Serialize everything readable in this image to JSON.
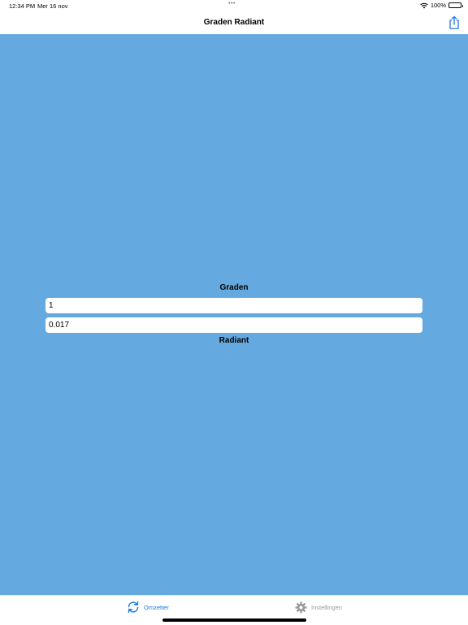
{
  "status_bar": {
    "time": "12:34 PM",
    "date": "Mer 16 nov",
    "multitask_dots": "•••",
    "battery_text": "100%",
    "wifi_icon": "wifi-icon",
    "battery_icon": "battery-icon"
  },
  "nav": {
    "title": "Graden Radiant",
    "share_icon": "share-icon"
  },
  "converter": {
    "top_label": "Graden",
    "degrees_value": "1",
    "radians_value": "0.017",
    "bottom_label": "Radiant",
    "background_color": "#64a9e0"
  },
  "tabs": [
    {
      "label": "Omzetter",
      "icon": "sync-icon",
      "selected": true,
      "color": "#1f7ae0"
    },
    {
      "label": "Instellingen",
      "icon": "gear-icon",
      "selected": false,
      "color": "#9a9a9a"
    }
  ]
}
